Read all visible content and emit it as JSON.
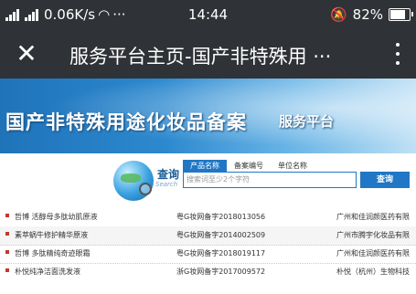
{
  "statusbar": {
    "network_speed": "0.06K/s",
    "more": "···",
    "time": "14:44",
    "battery": "82%",
    "battery_level": 0.82
  },
  "appbar": {
    "close_icon": "close-icon",
    "title": "服务平台主页-国产非特殊用 ···",
    "menu_icon": "more-vertical-icon"
  },
  "banner": {
    "title": "国产非特殊用途化妆品备案",
    "subtitle": "服务平台"
  },
  "search": {
    "label": "查询",
    "sublabel": "Search",
    "tabs": [
      "产品名称",
      "备案编号",
      "单位名称"
    ],
    "placeholder": "搜索词至少2个字符",
    "button": "查询"
  },
  "results": [
    {
      "name": "哲博 活醇母多肽幼肌原液",
      "reg": "粤G妆网备字2018013056",
      "company": "广州和佳润颜医药有限"
    },
    {
      "name": "素萃蜗牛修护精华原液",
      "reg": "粤G妆网备字2014002509",
      "company": "广州市腾宇化妆品有限"
    },
    {
      "name": "哲博 多肽精纯奇迹眼霜",
      "reg": "粤G妆网备字2018019117",
      "company": "广州和佳润颜医药有限"
    },
    {
      "name": "朴悦纯净洁面洗发液",
      "reg": "浙G妆网备字2017009572",
      "company": "朴悦（杭州）生物科技"
    }
  ]
}
